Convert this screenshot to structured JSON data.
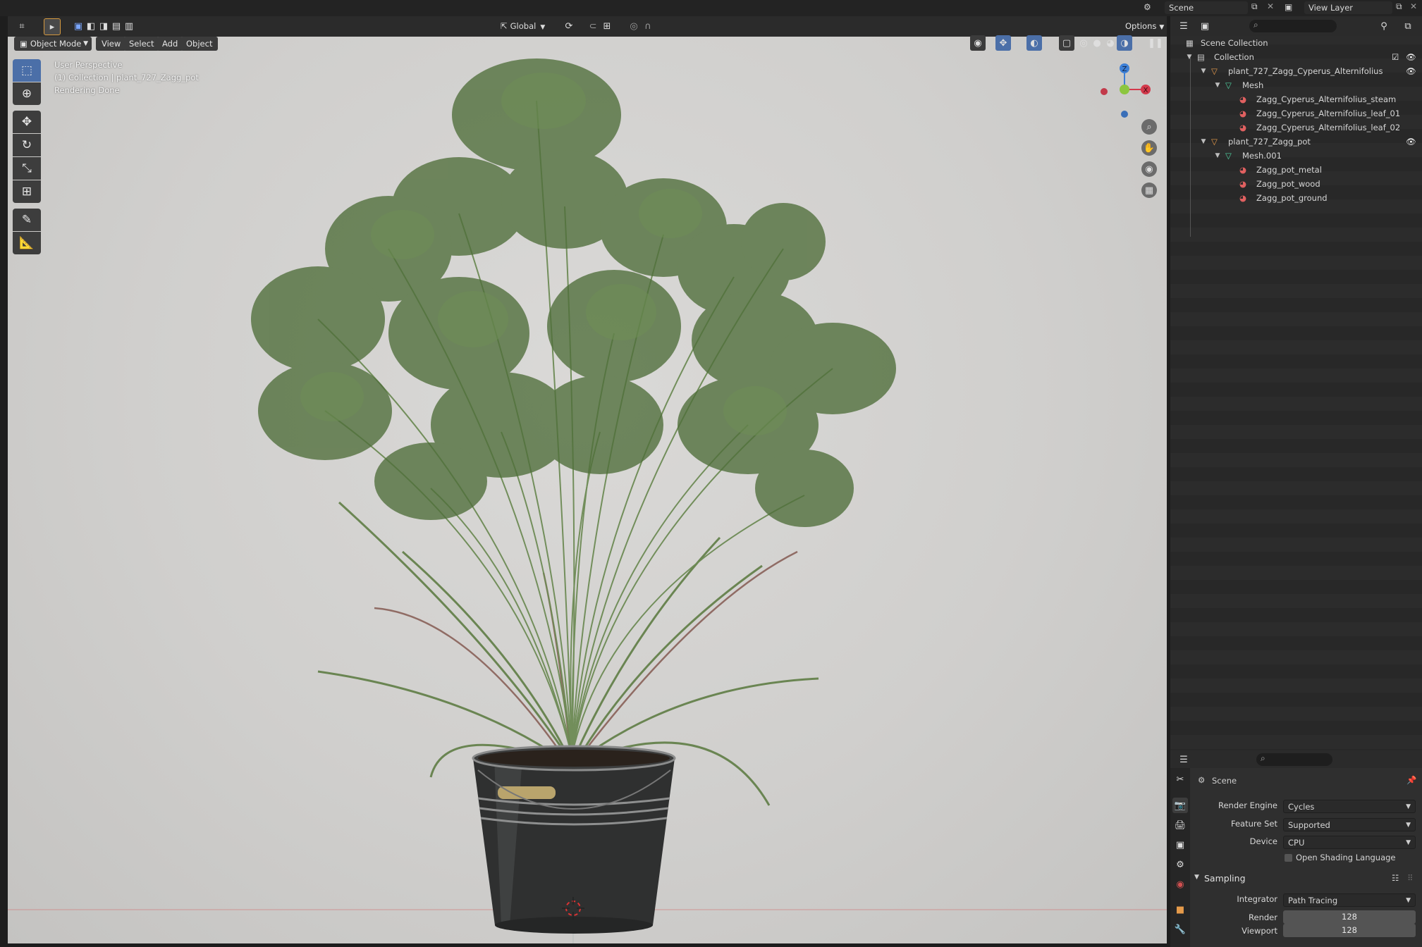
{
  "topbar": {
    "scene_name": "Scene",
    "view_layer_name": "View Layer"
  },
  "viewport": {
    "mode_label": "Object Mode",
    "menus": [
      "View",
      "Select",
      "Add",
      "Object"
    ],
    "transform_orientation": "Global",
    "options_label": "Options",
    "overlay_lines": [
      "User Perspective",
      "(1) Collection | plant_727_Zagg_pot",
      "Rendering Done"
    ],
    "gizmo": {
      "z": "Z",
      "x": "X"
    },
    "colors": {
      "x_axis": "#d3394b",
      "y_axis": "#8cc63f",
      "z_axis": "#3c7fd6",
      "active_tool": "#4b6fa8"
    }
  },
  "toolbar": {
    "tools": [
      "select-box",
      "cursor",
      "move",
      "rotate",
      "scale",
      "transform",
      "annotate",
      "measure"
    ]
  },
  "outliner": {
    "items": [
      {
        "label": "Scene Collection",
        "depth": 0,
        "icon": "scene-collection-icon"
      },
      {
        "label": "Collection",
        "depth": 1,
        "icon": "collection-icon"
      },
      {
        "label": "plant_727_Zagg_Cyperus_Alternifolius",
        "depth": 2,
        "icon": "object-icon"
      },
      {
        "label": "Mesh",
        "depth": 3,
        "icon": "mesh-icon"
      },
      {
        "label": "Zagg_Cyperus_Alternifolius_steam",
        "depth": 4,
        "icon": "material-icon"
      },
      {
        "label": "Zagg_Cyperus_Alternifolius_leaf_01",
        "depth": 4,
        "icon": "material-icon"
      },
      {
        "label": "Zagg_Cyperus_Alternifolius_leaf_02",
        "depth": 4,
        "icon": "material-icon"
      },
      {
        "label": "plant_727_Zagg_pot",
        "depth": 2,
        "icon": "object-icon"
      },
      {
        "label": "Mesh.001",
        "depth": 3,
        "icon": "mesh-icon"
      },
      {
        "label": "Zagg_pot_metal",
        "depth": 4,
        "icon": "material-icon"
      },
      {
        "label": "Zagg_pot_wood",
        "depth": 4,
        "icon": "material-icon"
      },
      {
        "label": "Zagg_pot_ground",
        "depth": 4,
        "icon": "material-icon"
      }
    ]
  },
  "properties": {
    "context": "Scene",
    "render_engine_label": "Render Engine",
    "render_engine": "Cycles",
    "feature_set_label": "Feature Set",
    "feature_set": "Supported",
    "device_label": "Device",
    "device": "CPU",
    "osl_label": "Open Shading Language",
    "sampling_label": "Sampling",
    "integrator_label": "Integrator",
    "integrator": "Path Tracing",
    "render_label": "Render",
    "render_samples": "128",
    "viewport_label": "Viewport",
    "viewport_samples": "128"
  }
}
